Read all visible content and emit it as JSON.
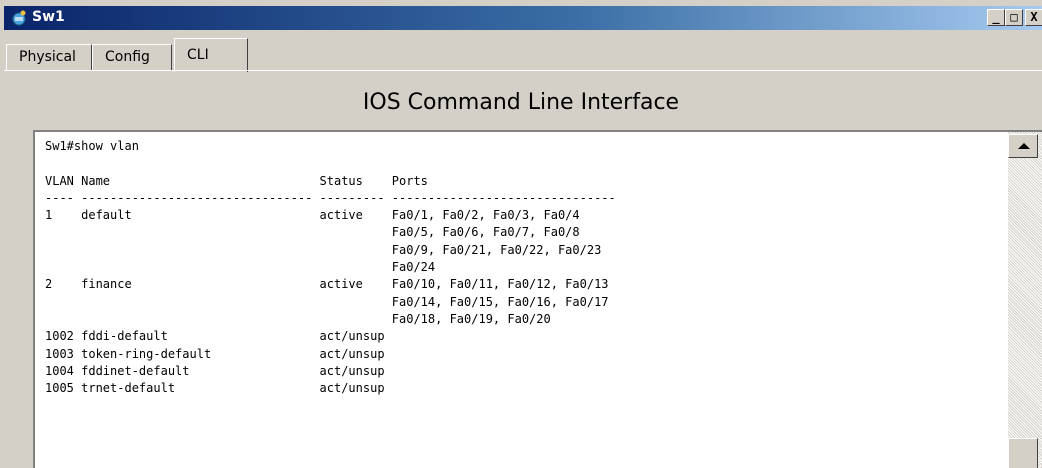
{
  "window": {
    "title": "Sw1",
    "icon": "cisco-switch-icon",
    "controls": {
      "minimize": "_",
      "maximize": "□",
      "close": "X"
    }
  },
  "tabs": [
    {
      "label": "Physical",
      "active": false
    },
    {
      "label": "Config",
      "active": false
    },
    {
      "label": "CLI",
      "active": true
    }
  ],
  "cli": {
    "heading": "IOS Command Line Interface",
    "output": "Sw1#show vlan\n\nVLAN Name                             Status    Ports\n---- -------------------------------- --------- -------------------------------\n1    default                          active    Fa0/1, Fa0/2, Fa0/3, Fa0/4\n                                                Fa0/5, Fa0/6, Fa0/7, Fa0/8\n                                                Fa0/9, Fa0/21, Fa0/22, Fa0/23\n                                                Fa0/24\n2    finance                          active    Fa0/10, Fa0/11, Fa0/12, Fa0/13\n                                                Fa0/14, Fa0/15, Fa0/16, Fa0/17\n                                                Fa0/18, Fa0/19, Fa0/20\n1002 fddi-default                     act/unsup\n1003 token-ring-default               act/unsup\n1004 fddinet-default                  act/unsup\n1005 trnet-default                    act/unsup"
  },
  "colors": {
    "titlebar_start": "#0a246a",
    "titlebar_end": "#a6caf0",
    "chrome": "#d4d0c8",
    "terminal_bg": "#ffffff"
  }
}
